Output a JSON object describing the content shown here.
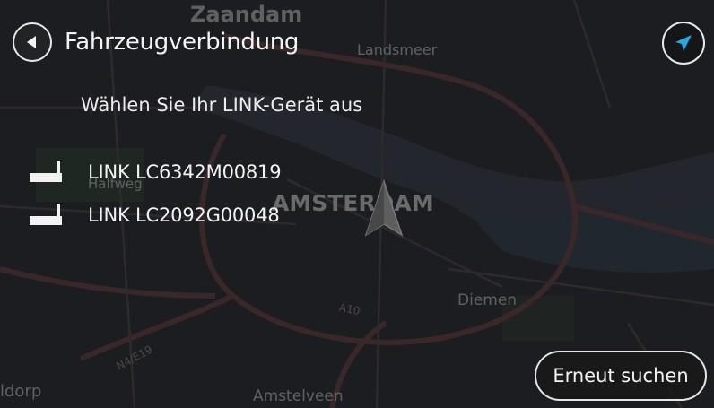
{
  "header": {
    "title": "Fahrzeugverbindung",
    "back_icon": "back-arrow-icon",
    "nav_icon": "navigation-arrow-icon",
    "nav_icon_color": "#29a9e1"
  },
  "subtitle": "Wählen Sie Ihr LINK-Gerät aus",
  "devices": [
    {
      "label": "LINK LC6342M00819",
      "icon": "link-device-icon"
    },
    {
      "label": "LINK LC2092G00048",
      "icon": "link-device-icon"
    }
  ],
  "search_button": {
    "label": "Erneut suchen"
  },
  "map": {
    "labels": {
      "zaandam": "Zaandam",
      "landsmeer": "Landsmeer",
      "halfweg": "Halfweg",
      "amsterdam": "AMSTERDAM",
      "diemen": "Diemen",
      "a10": "A10",
      "n4e19": "N4/E19",
      "amstelveen": "Amstelveen",
      "idorp": "ldorp"
    },
    "position_marker": "current-position-icon"
  }
}
